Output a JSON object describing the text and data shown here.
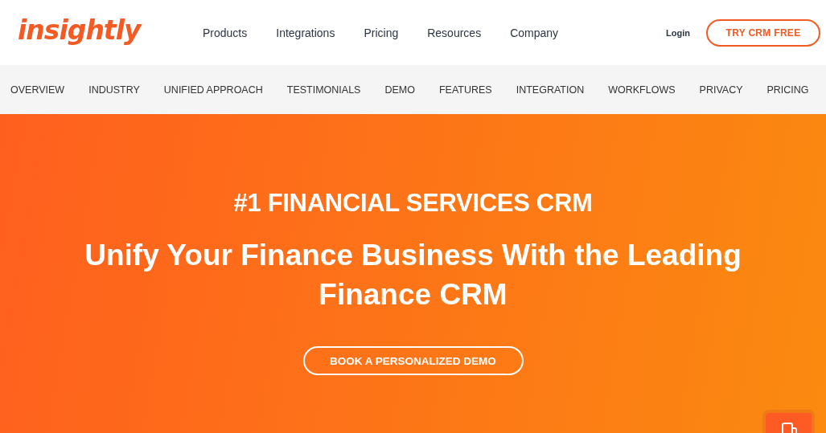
{
  "header": {
    "logo": "insightly",
    "nav": [
      "Products",
      "Integrations",
      "Pricing",
      "Resources",
      "Company"
    ],
    "login": "Login",
    "cta": "TRY CRM FREE"
  },
  "subnav": [
    "OVERVIEW",
    "INDUSTRY",
    "UNIFIED APPROACH",
    "TESTIMONIALS",
    "DEMO",
    "FEATURES",
    "INTEGRATION",
    "WORKFLOWS",
    "PRIVACY",
    "PRICING"
  ],
  "hero": {
    "eyebrow": "#1 FINANCIAL SERVICES CRM",
    "headline": "Unify Your Finance Business With the Leading Finance CRM",
    "button": "BOOK A PERSONALIZED DEMO"
  }
}
